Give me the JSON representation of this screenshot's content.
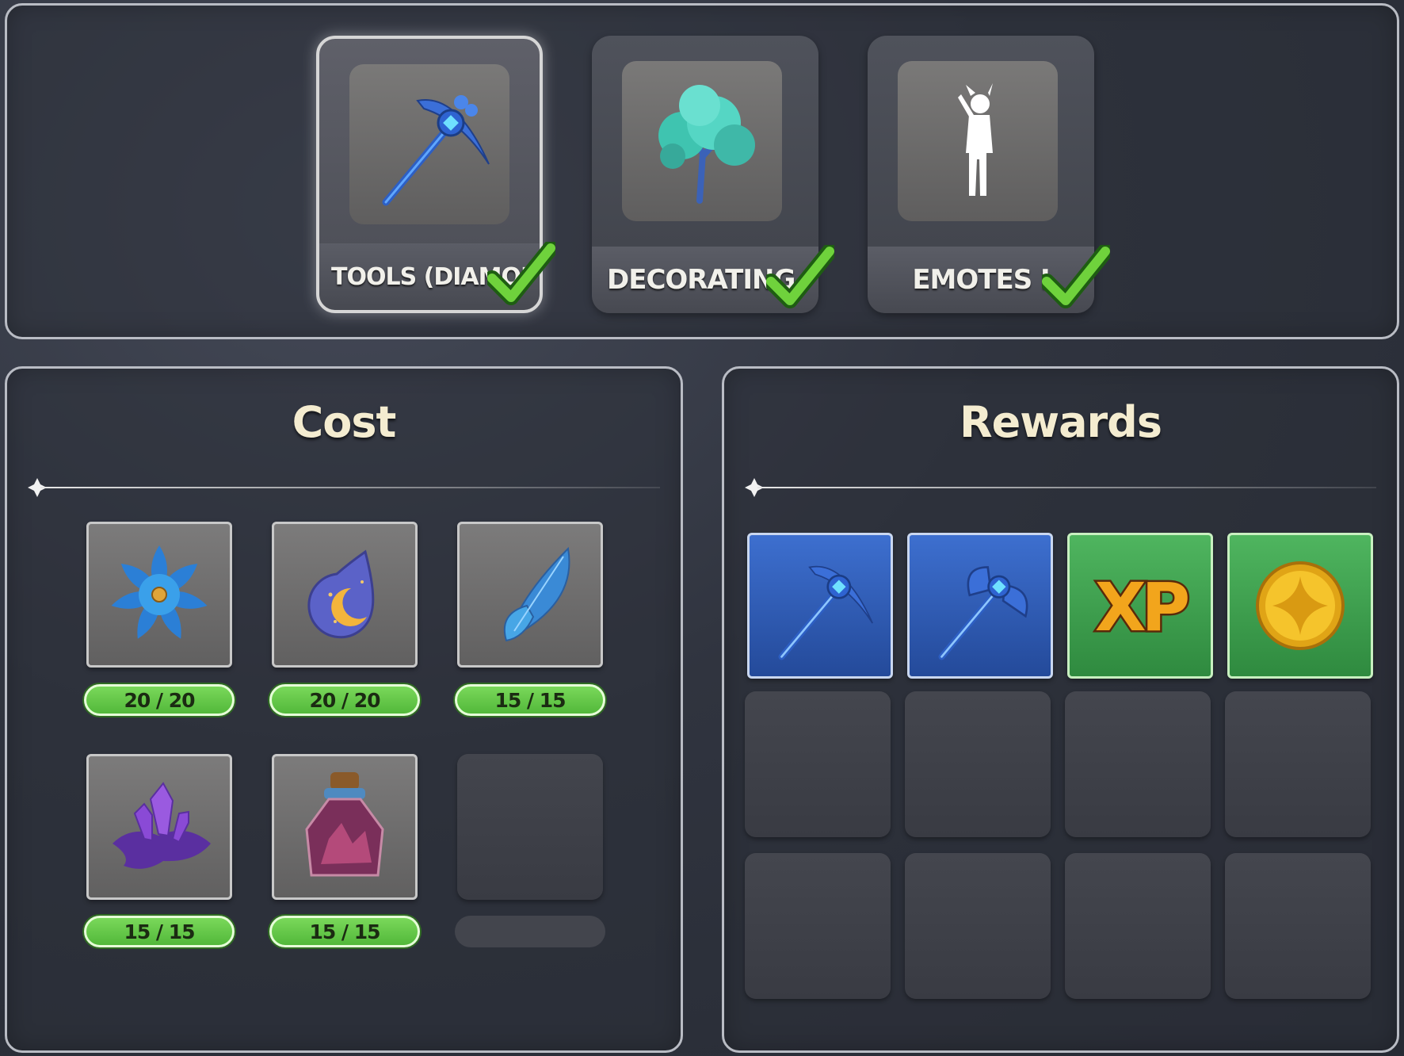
{
  "skills": [
    {
      "label": "TOOLS (DIAMOND)",
      "icon": "diamond-pickaxe-icon",
      "selected": true,
      "completed": true
    },
    {
      "label": "DECORATING V",
      "icon": "tree-icon",
      "selected": false,
      "completed": true
    },
    {
      "label": "EMOTES I",
      "icon": "emote-pose-icon",
      "selected": false,
      "completed": true
    }
  ],
  "cost": {
    "title": "Cost",
    "items": [
      {
        "icon": "blue-flower-icon",
        "progress": "20 / 20"
      },
      {
        "icon": "moon-drop-icon",
        "progress": "20 / 20"
      },
      {
        "icon": "fairy-wing-icon",
        "progress": "15 / 15"
      },
      {
        "icon": "amethyst-crystal-icon",
        "progress": "15 / 15"
      },
      {
        "icon": "potion-bottle-icon",
        "progress": "15 / 15"
      }
    ]
  },
  "rewards": {
    "title": "Rewards",
    "items": [
      {
        "icon": "diamond-pickaxe-icon",
        "color": "blue"
      },
      {
        "icon": "diamond-axe-icon",
        "color": "blue"
      },
      {
        "icon": "xp-icon",
        "text": "XP",
        "color": "green"
      },
      {
        "icon": "gold-coin-icon",
        "color": "green"
      }
    ]
  },
  "colors": {
    "progress_fill": "#6fd24f",
    "reward_blue": "#3462c0",
    "reward_green": "#3f9f4f",
    "title_text": "#f4ecd0"
  }
}
